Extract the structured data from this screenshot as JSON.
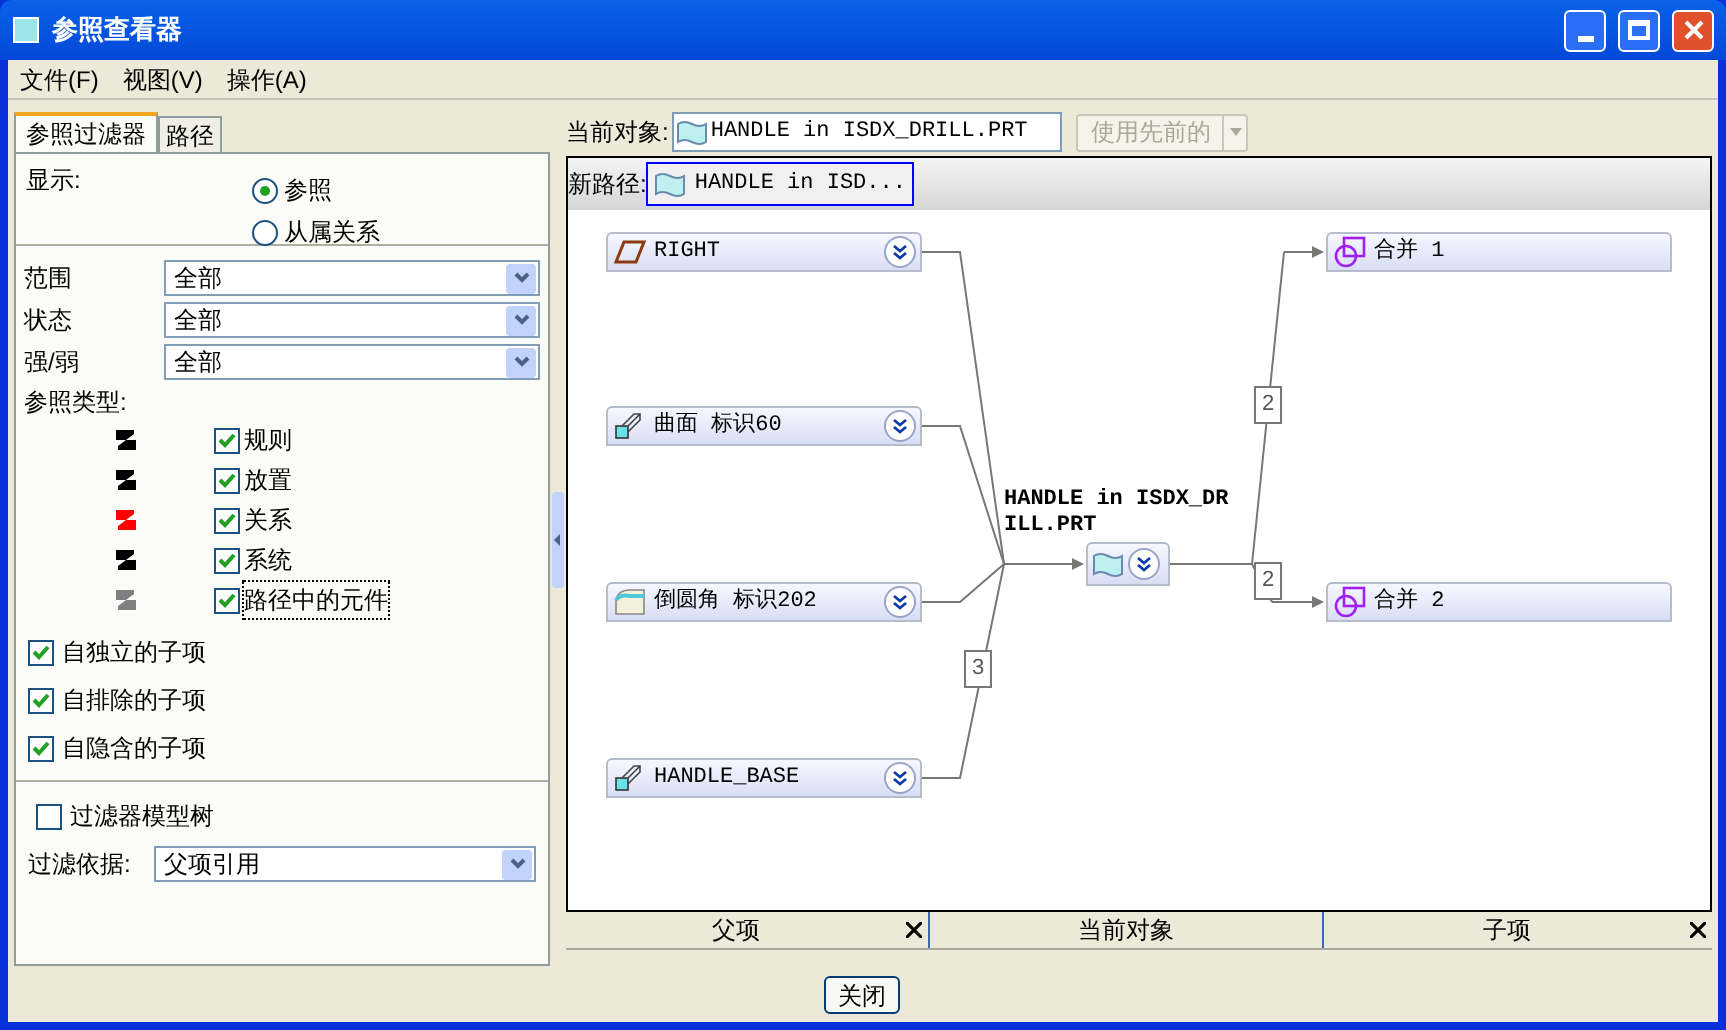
{
  "window": {
    "title": "参照查看器"
  },
  "menu": [
    {
      "label": "文件(F)"
    },
    {
      "label": "视图(V)"
    },
    {
      "label": "操作(A)"
    }
  ],
  "tabs": [
    {
      "label": "参照过滤器",
      "selected": true
    },
    {
      "label": "路径",
      "selected": false
    }
  ],
  "display": {
    "label": "显示:",
    "options": [
      {
        "label": "参照",
        "selected": true
      },
      {
        "label": "从属关系",
        "selected": false
      }
    ]
  },
  "filters": [
    {
      "label": "范围",
      "value": "全部"
    },
    {
      "label": "状态",
      "value": "全部"
    },
    {
      "label": "强/弱",
      "value": "全部"
    }
  ],
  "ref_types_label": "参照类型:",
  "ref_types": [
    {
      "label": "规则",
      "checked": true,
      "color": "#000000",
      "focused": false
    },
    {
      "label": "放置",
      "checked": true,
      "color": "#000000",
      "focused": false
    },
    {
      "label": "关系",
      "checked": true,
      "color": "#ff0000",
      "focused": false
    },
    {
      "label": "系统",
      "checked": true,
      "color": "#000000",
      "focused": false
    },
    {
      "label": "路径中的元件",
      "checked": true,
      "color": "#808080",
      "focused": true
    }
  ],
  "child_options": [
    {
      "label": "自独立的子项",
      "checked": true
    },
    {
      "label": "自排除的子项",
      "checked": true
    },
    {
      "label": "自隐含的子项",
      "checked": true
    }
  ],
  "filter_tree": {
    "label": "过滤器模型树",
    "checked": false
  },
  "filter_by": {
    "label": "过滤依据:",
    "value": "父项引用"
  },
  "current_object": {
    "label": "当前对象:",
    "value": "HANDLE in ISDX_DRILL.PRT"
  },
  "use_previous": {
    "label": "使用先前的",
    "disabled": true
  },
  "new_path": {
    "label": "新路径:",
    "value": "HANDLE in ISD..."
  },
  "graph": {
    "center_label": "HANDLE in ISDX_DRILL.PRT",
    "parents": [
      {
        "label": "RIGHT",
        "kind": "plane"
      },
      {
        "label": "曲面 标识60",
        "kind": "surface"
      },
      {
        "label": "倒圆角 标识202",
        "kind": "round"
      },
      {
        "label": "HANDLE_BASE",
        "kind": "surface",
        "count": "3"
      }
    ],
    "children": [
      {
        "label": "合并 1",
        "kind": "merge",
        "count": "2"
      },
      {
        "label": "合并 2",
        "kind": "merge",
        "count": "2"
      }
    ]
  },
  "columns": [
    {
      "label": "父项",
      "closable": true
    },
    {
      "label": "当前对象",
      "closable": false
    },
    {
      "label": "子项",
      "closable": true
    }
  ],
  "close_button": "关闭"
}
